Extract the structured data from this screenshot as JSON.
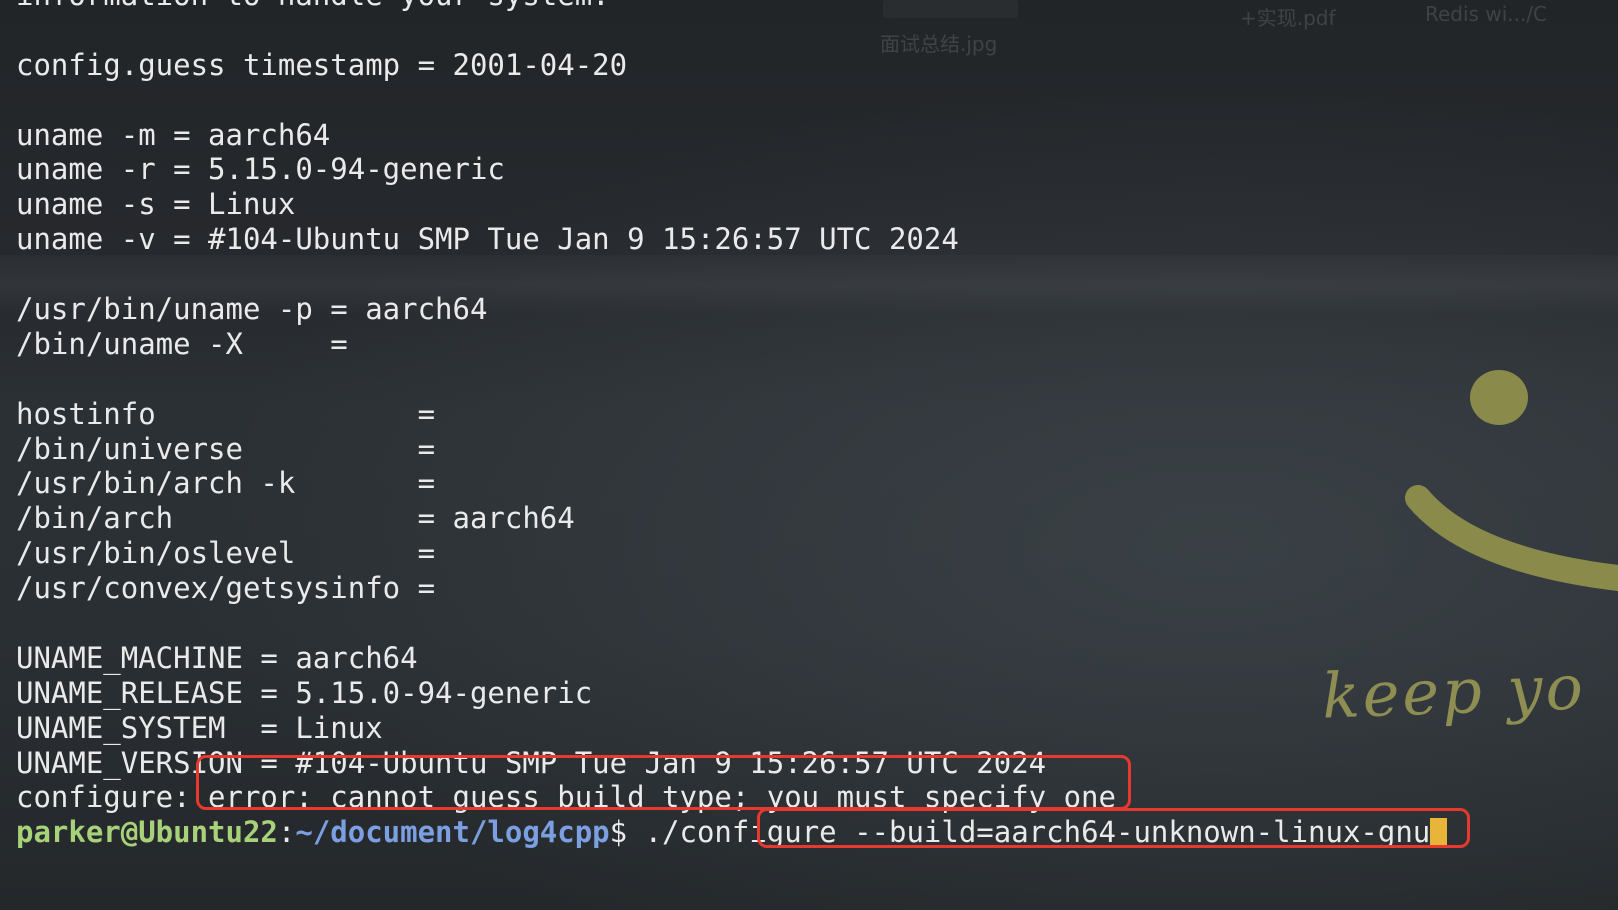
{
  "desktop": {
    "files": [
      "面试总结.jpg",
      "+实现.pdf",
      "Redis wi.../C"
    ],
    "wallpaper_text": "keep yo"
  },
  "terminal": {
    "lines": [
      "information to handle your system.",
      "",
      "config.guess timestamp = 2001-04-20",
      "",
      "uname -m = aarch64",
      "uname -r = 5.15.0-94-generic",
      "uname -s = Linux",
      "uname -v = #104-Ubuntu SMP Tue Jan 9 15:26:57 UTC 2024",
      "",
      "/usr/bin/uname -p = aarch64",
      "/bin/uname -X     =",
      "",
      "hostinfo               =",
      "/bin/universe          =",
      "/usr/bin/arch -k       =",
      "/bin/arch              = aarch64",
      "/usr/bin/oslevel       =",
      "/usr/convex/getsysinfo =",
      "",
      "UNAME_MACHINE = aarch64",
      "UNAME_RELEASE = 5.15.0-94-generic",
      "UNAME_SYSTEM  = Linux",
      "UNAME_VERSION = #104-Ubuntu SMP Tue Jan 9 15:26:57 UTC 2024",
      "configure: error: cannot guess build type; you must specify one"
    ],
    "prompt": {
      "user_host": "parker@Ubuntu22",
      "colon": ":",
      "path": "~/document/log4cpp",
      "symbol": "$ ",
      "command": "./configure --build=aarch64-unknown-linux-gnu"
    }
  },
  "colors": {
    "prompt_user": "#a8d27a",
    "prompt_path": "#7b9fe0",
    "cursor": "#e8b43a",
    "annotation_box": "#e8392e",
    "text": "#eaeaea"
  }
}
